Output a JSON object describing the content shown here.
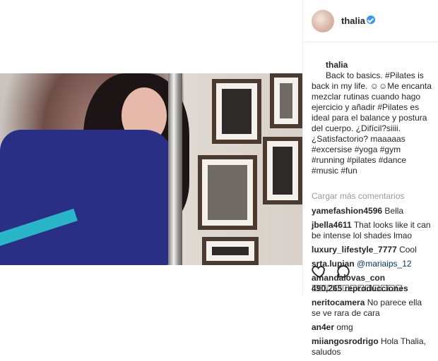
{
  "profile": {
    "username": "thalia"
  },
  "caption": {
    "username": "thalia",
    "text": "Back to basics. #Pilates is back in my life. ☺☺Me encanta mezclar rutinas cuando hago ejercicio y añadir #Pilates es ideal para el balance y postura del cuerpo. ¿Difícil?siiii. ¿Satisfactorio? maaaaas #excersise #yoga #gym #running #pilates #dance #music #fun"
  },
  "load_more_label": "Cargar más comentarios",
  "comments": [
    {
      "user": "yamefashion4596",
      "text": "Bella"
    },
    {
      "user": "jbella4611",
      "text": "That looks like it can be intense lol shades lmao"
    },
    {
      "user": "luxury_lifestyle_7777",
      "text": "Cool"
    },
    {
      "user": "srta.lupian",
      "text": "@mariaips_12"
    },
    {
      "user": "amandalovas_con",
      "text": "☐☐☐☐☐☐☐☐☐☐☐☐"
    },
    {
      "user": "neritocamera",
      "text": "No parece ella se ve rara de cara"
    },
    {
      "user": "an4er",
      "text": "omg"
    },
    {
      "user": "miiangosrodrigo",
      "text": "Hola Thalia, saludos"
    }
  ],
  "metrics": {
    "views": "490,265 reproducciones"
  },
  "icons": {
    "like": "heart-icon",
    "comment": "comment-icon",
    "verified": "verified-badge-icon"
  }
}
